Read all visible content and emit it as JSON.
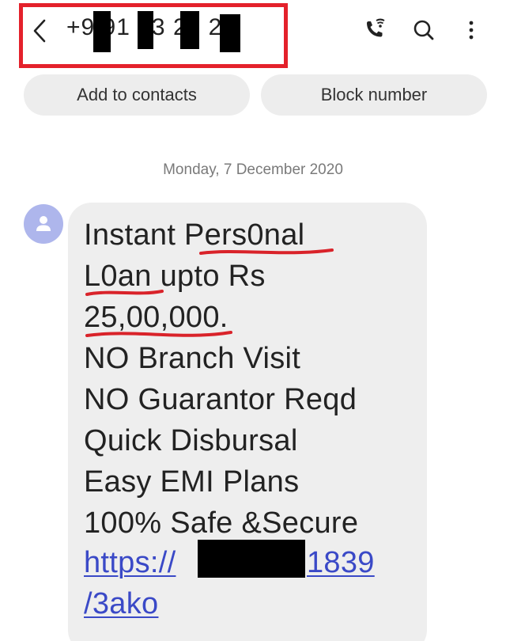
{
  "header": {
    "phone_number_visible": "+9  91  93  27  2",
    "icons": [
      "back-arrow-icon",
      "wifi-call-icon",
      "search-icon",
      "more-vert-icon"
    ],
    "highlight_color": "#e4212b"
  },
  "actions": {
    "add_label": "Add to contacts",
    "block_label": "Block number"
  },
  "conversation": {
    "date": "Monday, 7 December 2020",
    "message": {
      "lines": [
        "Instant Pers0nal",
        "L0an upto Rs",
        "25,00,000.",
        "NO Branch Visit",
        "NO Guarantor Reqd",
        "Quick Disbursal",
        "Easy EMI Plans",
        "100% Safe &Secure"
      ],
      "link_visible_start": "https://",
      "link_visible_end": "1839",
      "link_line_2": "/3ako",
      "link_color": "#3a49c7",
      "annotation_color": "#d9232a"
    }
  }
}
